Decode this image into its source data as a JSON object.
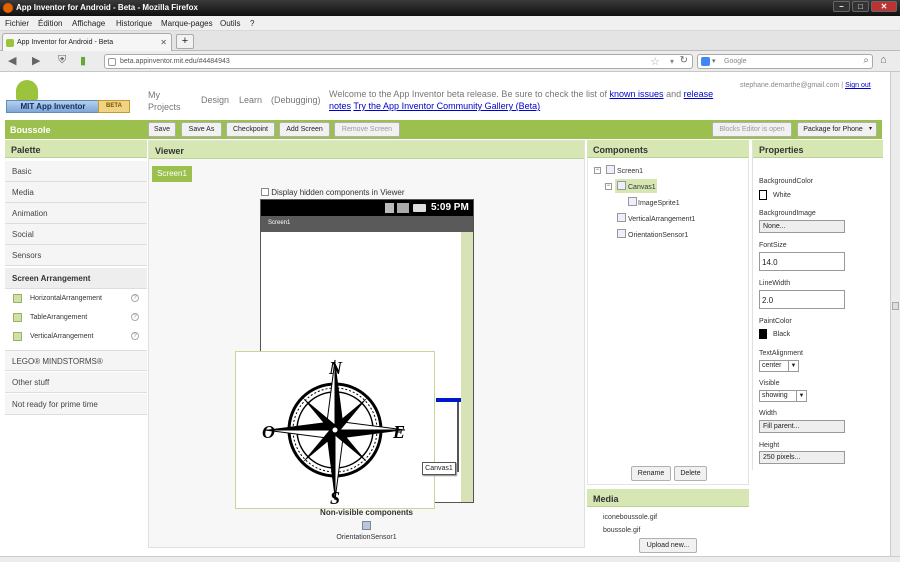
{
  "window": {
    "title": "App Inventor for Android - Beta - Mozilla Firefox"
  },
  "menu": [
    "Fichier",
    "Édition",
    "Affichage",
    "Historique",
    "Marque-pages",
    "Outils",
    "?"
  ],
  "tab": {
    "label": "App Inventor for Android - Beta"
  },
  "address": {
    "url": "beta.appinventor.mit.edu/#4484943",
    "search_placeholder": "Google"
  },
  "header": {
    "logo_text": "MIT App Inventor",
    "logo_badge": "BETA",
    "nav": [
      "My Projects",
      "Design",
      "Learn",
      "(Debugging)"
    ],
    "welcome_text": "Welcome to the App Inventor beta release. Be sure to check the list of",
    "known_issues": "known issues",
    "and": "and",
    "release_notes": "release notes",
    "gallery": "Try the App Inventor Community Gallery (Beta)",
    "user_email": "stephane.demarthe@gmail.com",
    "separator": "|",
    "sign_out": "Sign out"
  },
  "project": {
    "name": "Boussole",
    "buttons": [
      "Save",
      "Save As",
      "Checkpoint",
      "Add Screen",
      "Remove Screen"
    ],
    "blocks_editor": "Blocks Editor is open",
    "package": "Package for Phone"
  },
  "palette": {
    "title": "Palette",
    "categories": [
      "Basic",
      "Media",
      "Animation",
      "Social",
      "Sensors"
    ],
    "open_category": "Screen Arrangement",
    "components": [
      "HorizontalArrangement",
      "TableArrangement",
      "VerticalArrangement"
    ],
    "more_categories": [
      "LEGO® MINDSTORMS®",
      "Other stuff",
      "Not ready for prime time"
    ]
  },
  "viewer": {
    "title": "Viewer",
    "screen_tab": "Screen1",
    "hidden_label": "Display hidden components in Viewer",
    "phone_time": "5:09 PM",
    "phone_title": "Screen1",
    "canvas_tooltip": "Canvas1",
    "compass_letters": {
      "n": "N",
      "s": "S",
      "e": "E",
      "o": "O"
    },
    "nonvisible_title": "Non-visible components",
    "nonvisible_item": "OrientationSensor1"
  },
  "components": {
    "title": "Components",
    "tree": [
      "Screen1",
      "Canvas1",
      "ImageSprite1",
      "VerticalArrangement1",
      "OrientationSensor1"
    ],
    "rename": "Rename",
    "delete": "Delete"
  },
  "media": {
    "title": "Media",
    "files": [
      "iconeboussole.gif",
      "boussole.gif"
    ],
    "upload": "Upload new..."
  },
  "properties": {
    "title": "Properties",
    "background_color_label": "BackgroundColor",
    "background_color_value": "White",
    "background_image_label": "BackgroundImage",
    "background_image_value": "None...",
    "font_size_label": "FontSize",
    "font_size_value": "14.0",
    "line_width_label": "LineWidth",
    "line_width_value": "2.0",
    "paint_color_label": "PaintColor",
    "paint_color_value": "Black",
    "text_alignment_label": "TextAlignment",
    "text_alignment_value": "center",
    "visible_label": "Visible",
    "visible_value": "showing",
    "width_label": "Width",
    "width_value": "Fill parent...",
    "height_label": "Height",
    "height_value": "250 pixels..."
  },
  "colors": {
    "accent_green": "#9cc04d",
    "panel_header": "#d6e7b4",
    "link": "#0000cc"
  },
  "icons": [
    "firefox-icon",
    "back-icon",
    "forward-icon",
    "home-icon",
    "bookmark-star-icon",
    "reload-icon",
    "search-icon",
    "compass-rose-icon"
  ]
}
